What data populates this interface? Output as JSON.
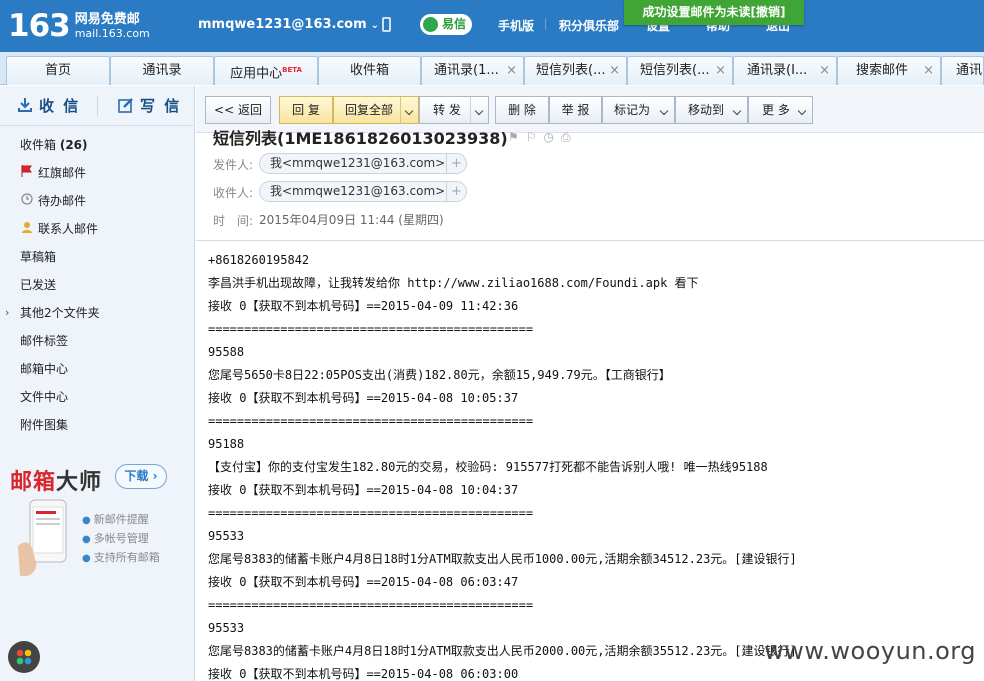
{
  "header": {
    "logo_number": "163",
    "logo_cn": "网易免费邮",
    "logo_domain": "mail.163.com",
    "account": "mmqwe1231@163.com",
    "yixin": "易信",
    "links": [
      "手机版",
      "积分俱乐部",
      "设置",
      "帮助",
      "退出"
    ]
  },
  "toast": {
    "text": "成功设置邮件为未读",
    "action": "[撤销]"
  },
  "tabs": [
    {
      "label": "首页",
      "closable": false
    },
    {
      "label": "通讯录",
      "closable": false
    },
    {
      "label": "应用中心",
      "beta": "BETA",
      "closable": false
    },
    {
      "label": "收件箱",
      "closable": false
    },
    {
      "label": "通讯录(1...",
      "closable": true
    },
    {
      "label": "短信列表(...",
      "closable": true
    },
    {
      "label": "短信列表(...",
      "closable": true
    },
    {
      "label": "通讯录(I...",
      "closable": true
    },
    {
      "label": "搜索邮件",
      "closable": true
    },
    {
      "label": "通讯",
      "closable": false
    }
  ],
  "tab_close": "×",
  "sidebar": {
    "receive": "收 信",
    "write": "写 信",
    "inbox": "收件箱",
    "inbox_count": "(26)",
    "items": [
      "红旗邮件",
      "待办邮件",
      "联系人邮件",
      "草稿箱",
      "已发送",
      "其他2个文件夹",
      "邮件标签",
      "邮箱中心",
      "文件中心",
      "附件图集"
    ]
  },
  "promo": {
    "title_red": "邮箱",
    "title_rest": "大师",
    "download": "下载",
    "features": [
      "新邮件提醒",
      "多帐号管理",
      "支持所有邮箱"
    ]
  },
  "toolbar": {
    "back": "<< 返回",
    "reply": "回 复",
    "reply_all": "回复全部",
    "forward": "转 发",
    "delete": "删 除",
    "report": "举 报",
    "mark_as": "标记为",
    "move_to": "移动到",
    "more": "更 多"
  },
  "mail": {
    "subject": "短信列表(1ME1861826013023938)",
    "from_label": "发件人:",
    "from": "我<mmqwe1231@163.com>",
    "to_label": "收件人:",
    "to": "我<mmqwe1231@163.com>",
    "date_label": "时　间:",
    "date": "2015年04月09日 11:44 (星期四)",
    "body": [
      "+8618260195842",
      "李昌洪手机出现故障，让我转发给你 http://www.ziliao1688.com/Foundi.apk 看下",
      "接收 0【获取不到本机号码】==2015-04-09 11:42:36",
      "=============================================",
      "95588",
      "您尾号5650卡8日22:05POS支出(消费)182.80元，余额15,949.79元。【工商银行】",
      "接收 0【获取不到本机号码】==2015-04-08 10:05:37",
      "=============================================",
      "95188",
      "【支付宝】你的支付宝发生182.80元的交易，校验码: 915577打死都不能告诉别人哦! 唯一热线95188",
      "接收 0【获取不到本机号码】==2015-04-08 10:04:37",
      "=============================================",
      "95533",
      "您尾号8383的储蓄卡账户4月8日18时1分ATM取款支出人民币1000.00元,活期余额34512.23元。[建设银行]",
      "接收 0【获取不到本机号码】==2015-04-08 06:03:47",
      "=============================================",
      "95533",
      "您尾号8383的储蓄卡账户4月8日18时1分ATM取款支出人民币2000.00元,活期余额35512.23元。[建设银行]",
      "接收 0【获取不到本机号码】==2015-04-08 06:03:00"
    ]
  },
  "watermark": "www.wooyun.org"
}
